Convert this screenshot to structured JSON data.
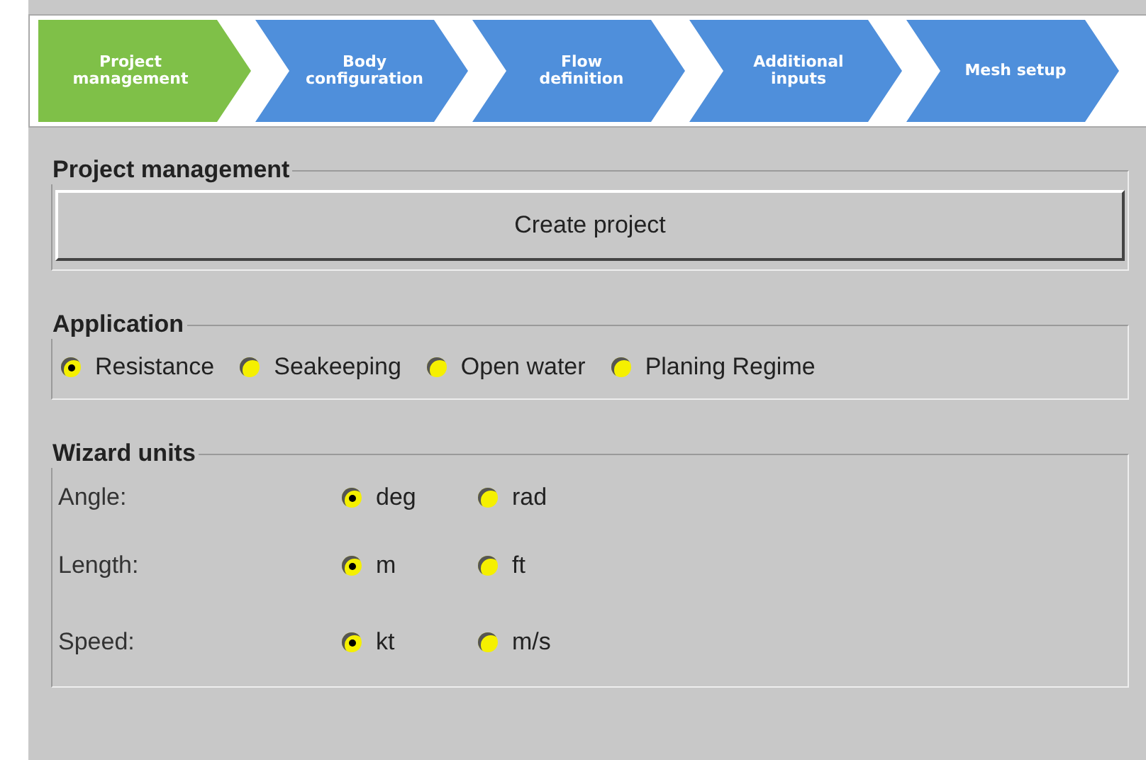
{
  "steps": [
    {
      "label": "Project management",
      "selected": true
    },
    {
      "label": "Body configuration",
      "selected": false
    },
    {
      "label": "Flow definition",
      "selected": false
    },
    {
      "label": "Additional inputs",
      "selected": false
    },
    {
      "label": "Mesh setup",
      "selected": false
    }
  ],
  "project_management": {
    "title": "Project management",
    "button": "Create project"
  },
  "application": {
    "title": "Application",
    "options": [
      {
        "label": "Resistance",
        "selected": true
      },
      {
        "label": "Seakeeping",
        "selected": false
      },
      {
        "label": "Open water",
        "selected": false
      },
      {
        "label": "Planing Regime",
        "selected": false
      }
    ]
  },
  "wizard_units": {
    "title": "Wizard units",
    "rows": [
      {
        "label": "Angle:",
        "options": [
          {
            "label": "deg",
            "selected": true
          },
          {
            "label": "rad",
            "selected": false
          }
        ]
      },
      {
        "label": "Length:",
        "options": [
          {
            "label": "m",
            "selected": true
          },
          {
            "label": "ft",
            "selected": false
          }
        ]
      },
      {
        "label": "Speed:",
        "options": [
          {
            "label": "kt",
            "selected": true
          },
          {
            "label": "m/s",
            "selected": false
          }
        ]
      }
    ]
  }
}
